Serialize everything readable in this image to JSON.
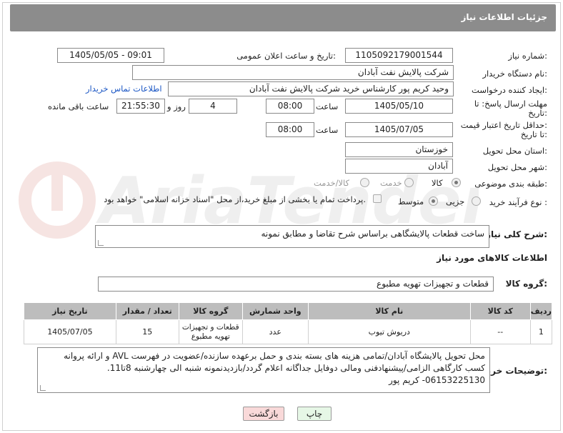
{
  "header": {
    "title": "جزئیات اطلاعات نیاز"
  },
  "form": {
    "need_number": {
      "label": "شماره نیاز:",
      "value": "1105092179001544"
    },
    "announce_datetime": {
      "label": "تاریخ و ساعت اعلان عمومی:",
      "value": "1405/05/05 - 09:01"
    },
    "buyer_org": {
      "label": "نام دستگاه خریدار:",
      "value": "شرکت پالایش نفت آبادان"
    },
    "creator": {
      "label": "ایجاد کننده درخواست:",
      "value": "وحید کریم پور کارشناس خرید  شرکت پالایش نفت آبادان",
      "contact_link": "اطلاعات تماس خریدار"
    },
    "reply_deadline": {
      "label_line1": "مهلت ارسال پاسخ: تا",
      "label_line2": "تاریخ:",
      "date": "1405/05/10",
      "time_label": "ساعت",
      "time": "08:00",
      "days": "4",
      "days_label": "روز و",
      "remaining": "21:55:30",
      "remaining_label": "ساعت باقی مانده"
    },
    "price_validity": {
      "label_line1": "حداقل تاریخ اعتبار قیمت:",
      "label_line2": "تا تاریخ:",
      "date": "1405/07/05",
      "time_label": "ساعت",
      "time": "08:00"
    },
    "province": {
      "label": "استان محل تحویل:",
      "value": "خوزستان"
    },
    "city": {
      "label": "شهر محل تحویل:",
      "value": "آبادان"
    },
    "category": {
      "label": "طبقه بندی موضوعی:",
      "options": [
        "کالا",
        "خدمت",
        "کالا/خدمت"
      ],
      "selected": "کالا"
    },
    "process": {
      "label": "نوع فرآیند خرید :",
      "options": [
        "جزیی",
        "متوسط"
      ],
      "selected": "متوسط",
      "payment_note": "پرداخت تمام یا بخشی از مبلغ خرید،از محل \"اسناد خزانه اسلامی\" خواهد بود."
    }
  },
  "description": {
    "label": "شرح کلی نیاز:",
    "value": "ساخت قطعات پالایشگاهی براساس شرح تقاضا و مطابق نمونه"
  },
  "goods_section": {
    "title": "اطلاعات کالاهای مورد نیاز"
  },
  "goods_group": {
    "label": "گروه کالا:",
    "value": "قطعات و تجهیزات تهویه مطبوع"
  },
  "table": {
    "headers": [
      "ردیف",
      "کد کالا",
      "نام کالا",
      "واحد شمارش",
      "گروه کالا",
      "تعداد / مقدار",
      "تاریخ نیاز"
    ],
    "rows": [
      [
        "1",
        "--",
        "دریوش تیوب",
        "عدد",
        "قطعات و تجهیزات تهویه مطبوع",
        "15",
        "1405/07/05"
      ]
    ]
  },
  "buyer_notes": {
    "label": "توضیحات خریدار:",
    "value": "محل تحویل پالایشگاه آبادان/تمامی هزینه های بسته بندی و حمل برعهده سازنده/عضویت در فهرست AVL و ارائه پروانه کسب کارگاهی الزامی/پیشنهادفنی ومالی دوفایل جداگانه اعلام گردد/بازدیدنمونه شنبه الی چهارشنبه 8تا11. 06153225130- کریم پور"
  },
  "buttons": {
    "print": "چاپ",
    "back": "بازگشت"
  },
  "colors": {
    "header_bg": "#8c8c8c",
    "table_header_bg": "#bdbdbd",
    "link": "#1a56c4",
    "back_button_bg": "#f9d9d9",
    "print_button_bg": "#e6f7e6"
  }
}
